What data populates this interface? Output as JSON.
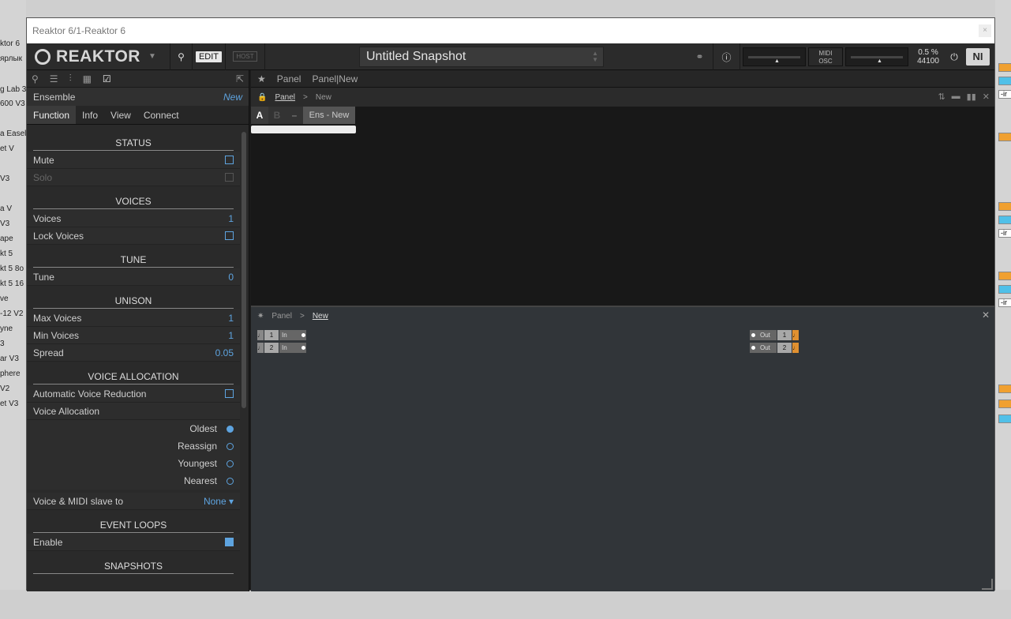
{
  "window": {
    "title": "Reaktor 6/1-Reaktor 6",
    "close": "×"
  },
  "toolbar": {
    "logo": "REAKTOR",
    "edit_label": "EDIT",
    "host_label": "HOST",
    "snapshot_name": "Untitled Snapshot",
    "midi_label": "MIDI",
    "osc_label": "OSC",
    "cpu": "0.5 %",
    "sample_rate": "44100",
    "ni_logo": "NI"
  },
  "sidebar": {
    "ensemble_label": "Ensemble",
    "ensemble_value": "New",
    "tabs": [
      "Function",
      "Info",
      "View",
      "Connect"
    ],
    "sections": {
      "status": "STATUS",
      "voices": "VOICES",
      "tune": "TUNE",
      "unison": "UNISON",
      "voice_allocation": "VOICE ALLOCATION",
      "event_loops": "EVENT LOOPS",
      "snapshots": "SNAPSHOTS"
    },
    "rows": {
      "mute": "Mute",
      "solo": "Solo",
      "voices": "Voices",
      "voices_val": "1",
      "lock_voices": "Lock Voices",
      "tune": "Tune",
      "tune_val": "0",
      "max_voices": "Max Voices",
      "max_voices_val": "1",
      "min_voices": "Min Voices",
      "min_voices_val": "1",
      "spread": "Spread",
      "spread_val": "0.05",
      "auto_reduction": "Automatic Voice Reduction",
      "voice_allocation": "Voice Allocation",
      "oldest": "Oldest",
      "reassign": "Reassign",
      "youngest": "Youngest",
      "nearest": "Nearest",
      "slave": "Voice & MIDI slave to",
      "slave_val": "None ▾",
      "enable": "Enable"
    }
  },
  "main": {
    "crumb": [
      "Panel",
      "Panel|New"
    ],
    "panel_bar": {
      "panel": "Panel",
      "sep": ">",
      "new": "New"
    },
    "snap": {
      "a": "A",
      "b": "B",
      "minus": "–",
      "ens": "Ens - New"
    },
    "struct_bar": {
      "panel": "Panel",
      "sep": ">",
      "new": "New"
    },
    "ports_in": [
      {
        "num": "1",
        "label": "In"
      },
      {
        "num": "2",
        "label": "In"
      }
    ],
    "ports_out": [
      {
        "num": "1",
        "label": "Out"
      },
      {
        "num": "2",
        "label": "Out"
      }
    ]
  },
  "background": {
    "left_items": [
      "ktor 6",
      "ярлык",
      "g Lab 3",
      "600 V3",
      "a Easel",
      "et V",
      "V3",
      "a V",
      "V3",
      "ape",
      "kt 5",
      "kt 5 8o",
      "kt 5 16",
      "ve",
      "-12 V2",
      "yne",
      "3",
      "ar V3",
      "phere",
      "V2",
      "et V3"
    ],
    "right_items": [
      "-ir",
      "-ir",
      "-ir"
    ]
  }
}
